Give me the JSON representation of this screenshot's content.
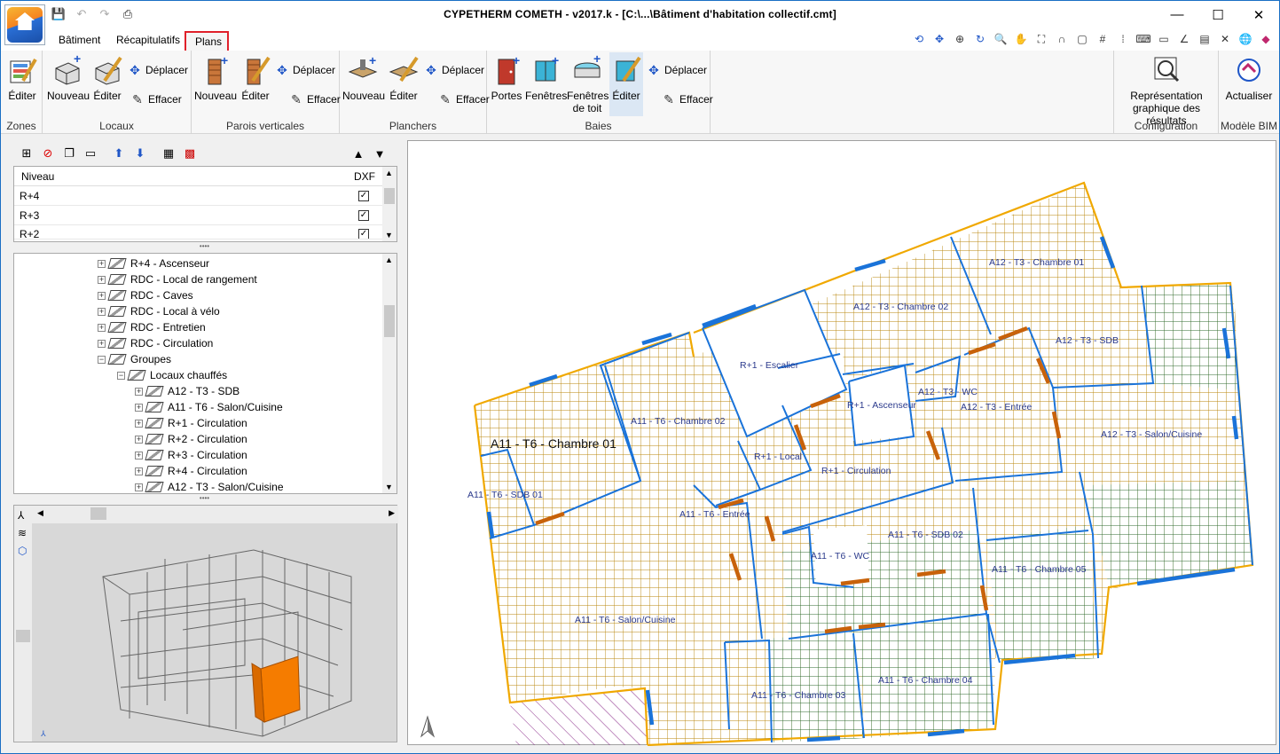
{
  "window": {
    "title": "CYPETHERM COMETH - v2017.k - [C:\\...\\Bâtiment d'habitation collectif.cmt]",
    "minimize": "—",
    "maximize": "☐",
    "close": "✕"
  },
  "tabs": [
    "Bâtiment",
    "Récapitulatifs",
    "Plans"
  ],
  "ribbon": {
    "zones": {
      "label": "Zones",
      "edit": "Éditer"
    },
    "locaux": {
      "label": "Locaux",
      "new": "Nouveau",
      "edit": "Éditer",
      "move": "Déplacer",
      "erase": "Effacer"
    },
    "parois": {
      "label": "Parois verticales",
      "new": "Nouveau",
      "edit": "Éditer",
      "move": "Déplacer",
      "erase": "Effacer"
    },
    "planchers": {
      "label": "Planchers",
      "new": "Nouveau",
      "edit": "Éditer",
      "move": "Déplacer",
      "erase": "Effacer"
    },
    "baies": {
      "label": "Baies",
      "doors": "Portes",
      "windows": "Fenêtres",
      "roof_windows_1": "Fenêtres",
      "roof_windows_2": "de toit",
      "edit": "Éditer",
      "move": "Déplacer",
      "erase": "Effacer"
    },
    "configuration": {
      "label": "Configuration",
      "results_1": "Représentation",
      "results_2": "graphique des résultats"
    },
    "bim": {
      "label": "Modèle BIM",
      "update": "Actualiser"
    }
  },
  "levels": {
    "header_name": "Niveau",
    "header_dxf": "DXF",
    "rows": [
      {
        "name": "R+4",
        "dxf": "✓"
      },
      {
        "name": "R+3",
        "dxf": "✓"
      },
      {
        "name": "R+2",
        "dxf": "✓"
      }
    ]
  },
  "tree": [
    "R+4 - Ascenseur",
    "RDC - Local de rangement",
    "RDC - Caves",
    "RDC - Local à vélo",
    "RDC - Entretien",
    "RDC - Circulation",
    "Groupes",
    "Locaux chauffés",
    "A12 - T3 - SDB",
    "A11 - T6 - Salon/Cuisine",
    "R+1 - Circulation",
    "R+2 - Circulation",
    "R+3 - Circulation",
    "R+4 - Circulation",
    "A12 - T3 - Salon/Cuisine"
  ],
  "plan": {
    "highlight_room": "A11 - T6 - Chambre 01",
    "rooms": [
      "A12 - T3 - Chambre 01",
      "A12 - T3 - Chambre 02",
      "A12 - T3 - SDB",
      "R+1 - Escalier",
      "A12 - T3 - WC",
      "A12 - T3 - Entrée",
      "R+1 - Ascenseur",
      "A11 - T6 - Chambre 02",
      "A12 - T3 - Salon/Cuisine",
      "R+1 - Local",
      "R+1 - Circulation",
      "A11 - T6 - SDB 01",
      "A11 - T6 - Entrée",
      "A11 - T6 - SDB 02",
      "A11 - T6 - WC",
      "A11 - T6 - Chambre 05",
      "A11 - T6 - Salon/Cuisine",
      "A11 - T6 - Chambre 04",
      "A11 - T6 - Chambre 03"
    ],
    "colors": {
      "exterior": "#f0a800",
      "partition": "#1a73d9",
      "door": "#c8620a",
      "grid_gold": "#b8860b",
      "grid_green": "#2f6b2f"
    }
  }
}
